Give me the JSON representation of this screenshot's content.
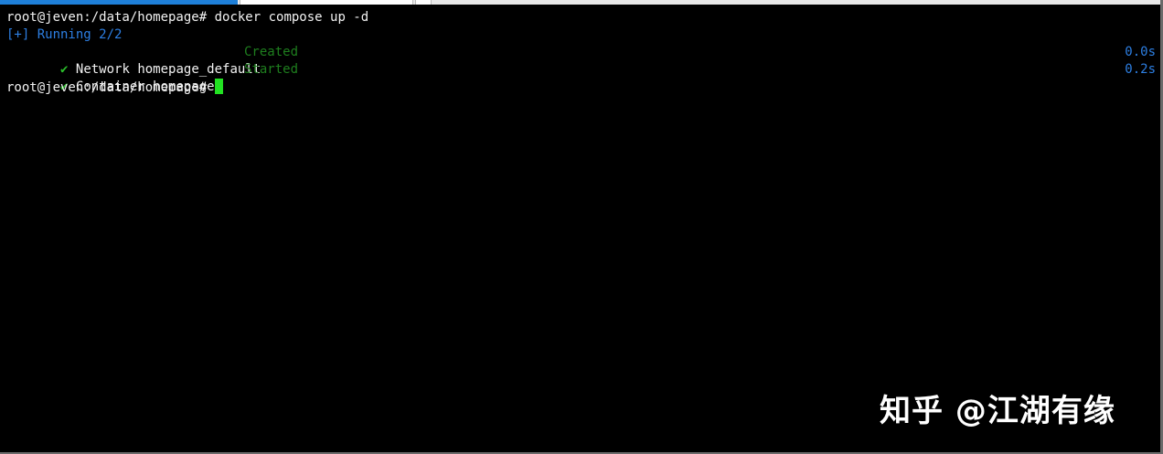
{
  "colors": {
    "background": "#000000",
    "foreground": "#f2f2f2",
    "running_blue": "#2d7fe3",
    "status_green": "#1e7e1e",
    "check_green": "#2bbf2b",
    "cursor_green": "#22e222",
    "tab_active": "#1e7fd8"
  },
  "terminal": {
    "prompt": "root@jeven:/data/homepage#",
    "command": " docker compose up -d",
    "running_text": "[+] Running 2/2",
    "items": [
      {
        "icon": "checkmark-icon",
        "check": "✔",
        "label": "Network homepage_default",
        "status": "Created",
        "time": "0.0s"
      },
      {
        "icon": "checkmark-icon",
        "check": "✔",
        "label": "Container homepage",
        "status": "Started",
        "time": "0.2s"
      }
    ],
    "final_prompt": "root@jeven:/data/homepage#"
  },
  "watermark": {
    "text": "知乎 @江湖有缘"
  }
}
